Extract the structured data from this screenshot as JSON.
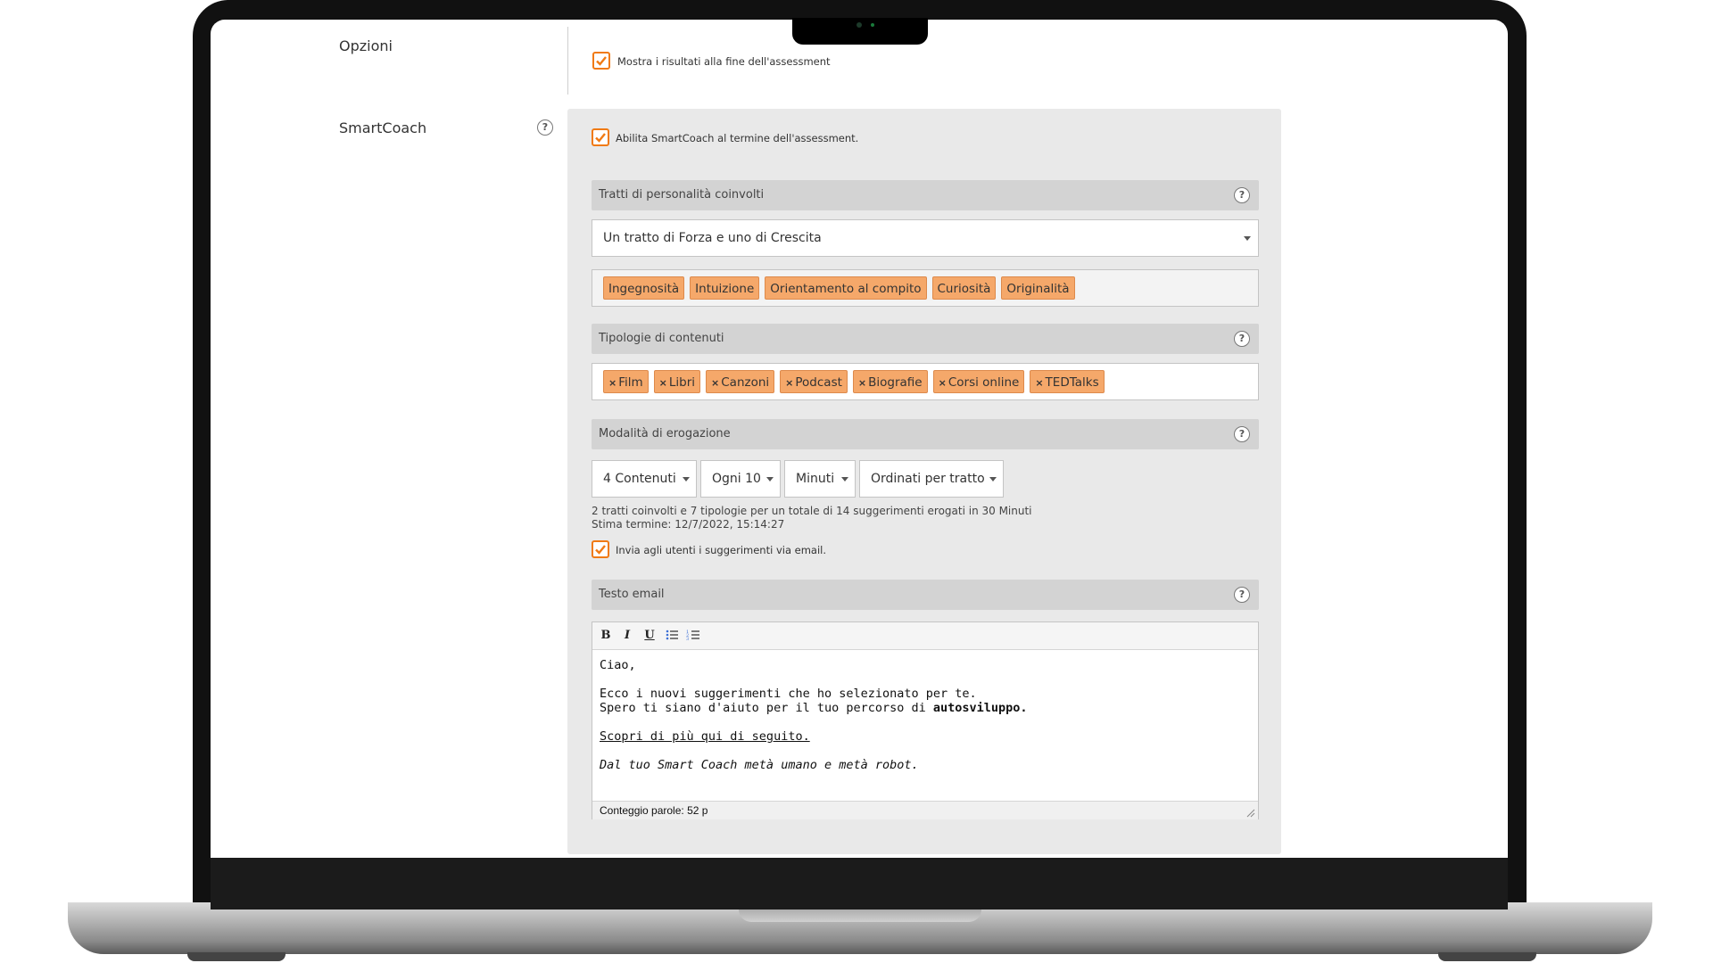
{
  "options": {
    "label": "Opzioni",
    "show_results_label": "Mostra i risultati alla fine dell'assessment",
    "show_results_checked": true
  },
  "smartcoach": {
    "label": "SmartCoach",
    "enable_label": "Abilita SmartCoach al termine dell'assessment.",
    "enable_checked": true,
    "traits": {
      "title": "Tratti di personalità coinvolti",
      "selected": "Un tratto di Forza e uno di Crescita",
      "tags": [
        "Ingegnosità",
        "Intuizione",
        "Orientamento al compito",
        "Curiosità",
        "Originalità"
      ]
    },
    "content_types": {
      "title": "Tipologie di contenuti",
      "remove_symbol": "×",
      "tags": [
        "Film",
        "Libri",
        "Canzoni",
        "Podcast",
        "Biografie",
        "Corsi online",
        "TEDTalks"
      ]
    },
    "delivery": {
      "title": "Modalità di erogazione",
      "count": "4 Contenuti",
      "every": "Ogni 10",
      "unit": "Minuti",
      "order": "Ordinati per tratto",
      "summary": "2 tratti coinvolti e 7 tipologie per un totale di 14 suggerimenti erogati in 30 Minuti",
      "estimate": "Stima termine: 12/7/2022, 15:14:27",
      "email_label": "Invia agli utenti i suggerimenti via email.",
      "email_checked": true
    },
    "email_text": {
      "title": "Testo email",
      "toolbar": {
        "bold": "B",
        "italic": "I",
        "underline": "U"
      },
      "greeting": "Ciao,",
      "line1": "Ecco i nuovi suggerimenti che ho selezionato per te.",
      "line2_prefix": "Spero ti siano d'aiuto per il tuo percorso di ",
      "line2_bold": "autosviluppo.",
      "link": "Scopri di più qui di seguito.",
      "signature": "Dal tuo Smart Coach metà umano e metà robot.",
      "word_count": "Conteggio parole: 52 p"
    }
  },
  "help_symbol": "?",
  "colors": {
    "accent": "#f07a14",
    "tag_bg": "#f5a86a",
    "panel_bg": "#e9e9e9"
  }
}
